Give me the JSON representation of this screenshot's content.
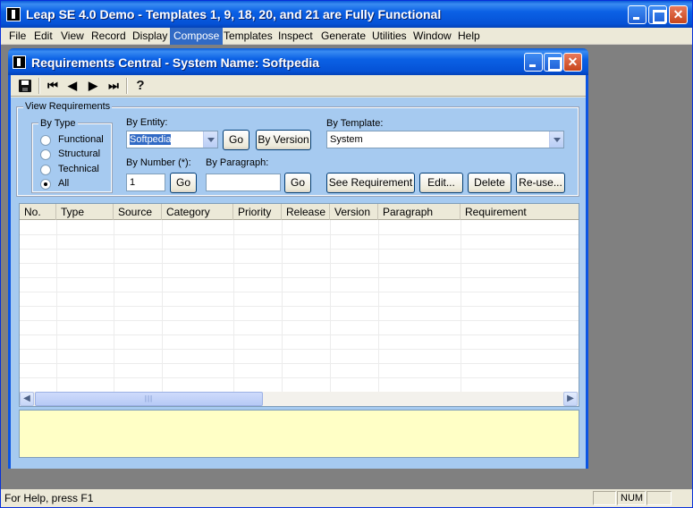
{
  "app": {
    "title": "Leap SE 4.0 Demo - Templates 1, 9, 18, 20, and 21 are Fully Functional",
    "colors": {
      "titlebar": "#0552d6",
      "content_bg": "#a6caf0",
      "memo_bg": "#ffffc6"
    }
  },
  "menu": [
    "File",
    "Edit",
    "View",
    "Record",
    "Display",
    "Compose",
    "Templates",
    "Inspect",
    "Generate",
    "Utilities",
    "Window",
    "Help"
  ],
  "menu_active": "Compose",
  "child": {
    "title": "Requirements Central - System Name: Softpedia"
  },
  "toolbar": {
    "icons": [
      "save-icon",
      "first-record-icon",
      "previous-record-icon",
      "next-record-icon",
      "last-record-icon",
      "help-icon"
    ]
  },
  "view_requirements": {
    "legend": "View Requirements",
    "by_type": {
      "legend": "By Type",
      "options": [
        "Functional",
        "Structural",
        "Technical",
        "All"
      ],
      "selected": "All"
    },
    "by_entity": {
      "label": "By Entity:",
      "value": "Softpedia",
      "go": "Go",
      "by_version": "By Version"
    },
    "by_template": {
      "label": "By Template:",
      "value": "System"
    },
    "by_number": {
      "label": "By Number (*):",
      "value": "1",
      "go": "Go"
    },
    "by_paragraph": {
      "label": "By Paragraph:",
      "value": "",
      "go": "Go"
    },
    "actions": {
      "see_requirement": "See Requirement",
      "edit": "Edit...",
      "delete": "Delete",
      "reuse": "Re-use..."
    }
  },
  "grid": {
    "columns": [
      "No.",
      "Type",
      "Source",
      "Category",
      "Priority",
      "Release",
      "Version",
      "Paragraph",
      "Requirement"
    ],
    "rows": []
  },
  "status": {
    "help": "For Help, press F1",
    "num": "NUM"
  }
}
